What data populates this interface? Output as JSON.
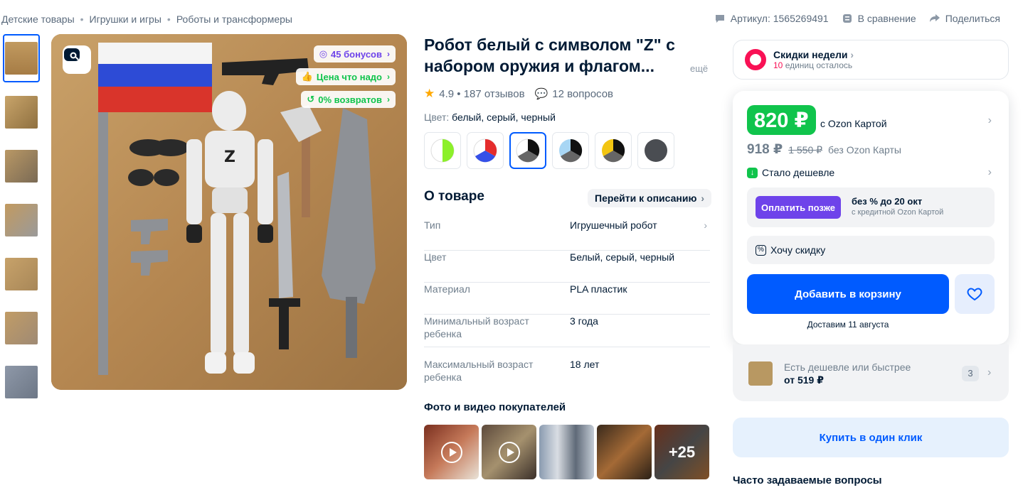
{
  "breadcrumb": [
    "Детские товары",
    "Игрушки и игры",
    "Роботы и трансформеры"
  ],
  "breadcrumb_sep": "•",
  "top_actions": {
    "article": "Артикул: 1565269491",
    "compare": "В сравнение",
    "share": "Поделиться"
  },
  "badges": {
    "bonus": "45 бонусов",
    "price_ok": "Цена что надо",
    "returns": "0% возвратов"
  },
  "product": {
    "title": "Робот белый с символом \"Z\" с набором оружия и флагом...",
    "more": "ещё",
    "rating": "4.9 • 187 отзывов",
    "questions": "12 вопросов",
    "color_label": "Цвет:",
    "color_value": "белый, серый, черный"
  },
  "about": {
    "title": "О товаре",
    "to_description": "Перейти к описанию",
    "specs": [
      {
        "k": "Тип",
        "v": "Игрушечный робот"
      },
      {
        "k": "Цвет",
        "v": "Белый, серый, черный"
      },
      {
        "k": "Материал",
        "v": "PLA пластик"
      },
      {
        "k": "Минимальный возраст ребенка",
        "v": "3 года"
      },
      {
        "k": "Максимальный возраст ребенка",
        "v": "18 лет"
      }
    ]
  },
  "buyer_photos": {
    "title": "Фото и видео покупателей",
    "more": "+25"
  },
  "sale": {
    "title": "Скидки недели",
    "count": "10",
    "rest": " единиц осталось"
  },
  "price": {
    "card_price": "820 ₽",
    "with_card": "с Ozon Картой",
    "price": "918 ₽",
    "old_price": "1 550 ₽",
    "without_card": "без Ozon Карты",
    "cheaper": "Стало дешевле",
    "pay_later_btn": "Оплатить позже",
    "pay_later_title": "без % до 20 окт",
    "pay_later_sub": "с кредитной Ozon Картой",
    "want_discount": "Хочу скидку",
    "add_to_cart": "Добавить в корзину",
    "delivery": "Доставим 11 августа"
  },
  "cheaper_offers": {
    "title": "Есть дешевле или быстрее",
    "price": "от 519 ₽",
    "count": "3"
  },
  "one_click": "Купить в один клик",
  "faq": "Часто задаваемые вопросы",
  "colors": {
    "accent": "#005bff",
    "green": "#10c44c",
    "pink": "#f91155",
    "purple": "#6e43ea"
  }
}
